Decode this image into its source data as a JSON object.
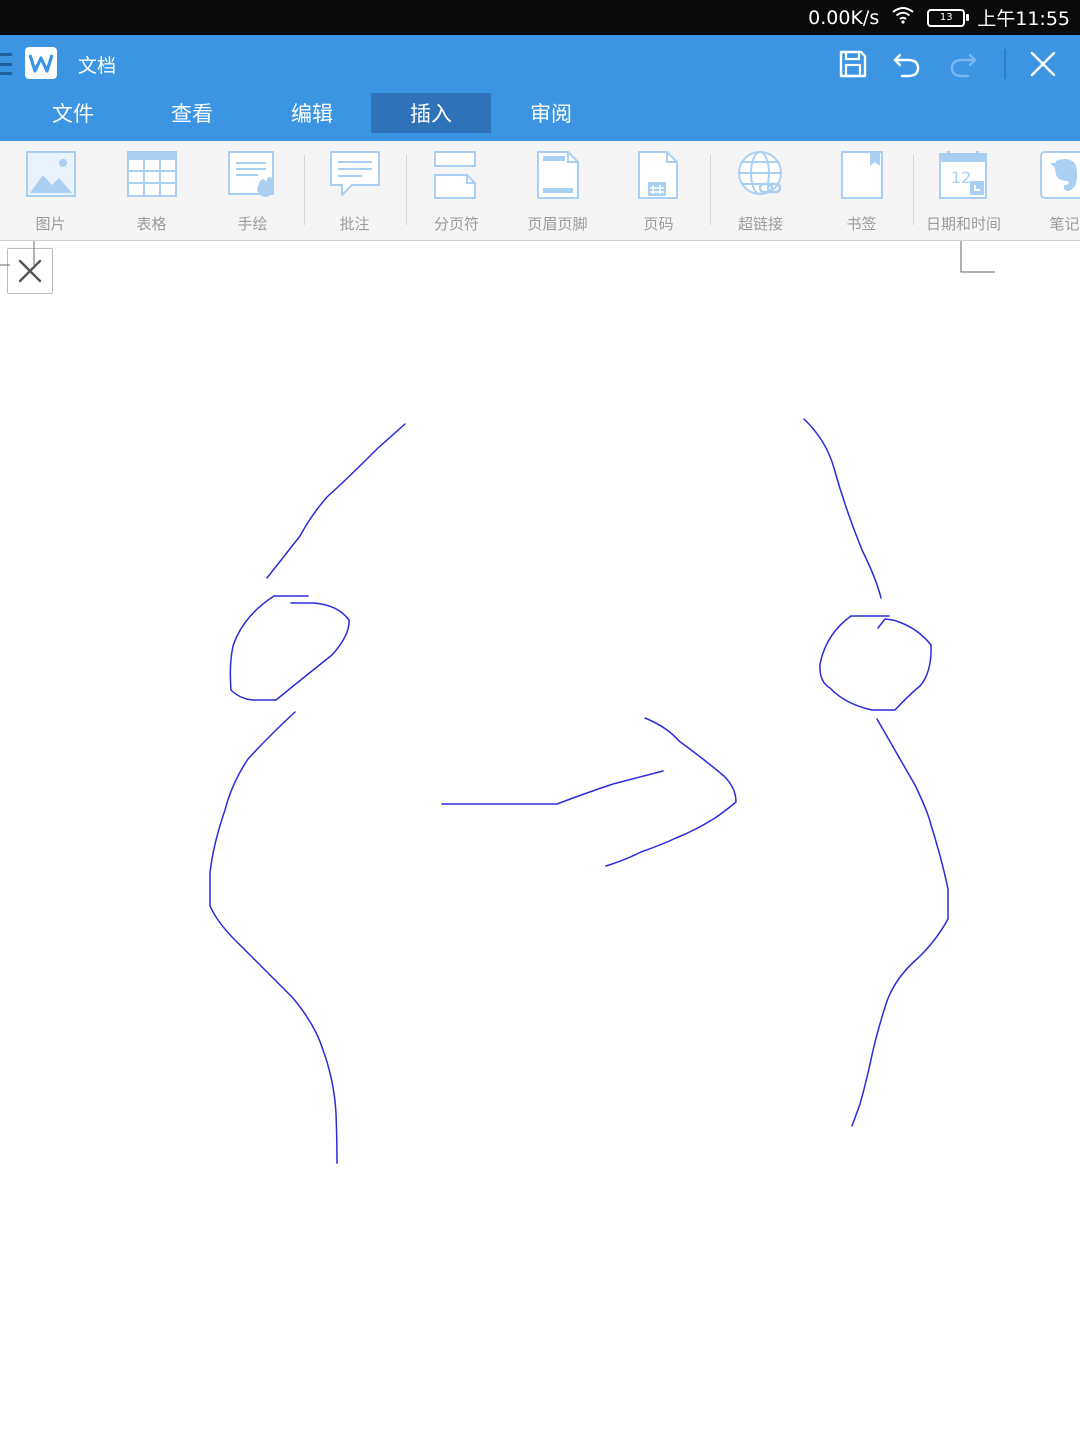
{
  "status_bar": {
    "network_speed": "0.00K/s",
    "battery_level": "13",
    "time": "上午11:55",
    "icons": [
      "wifi-icon",
      "battery-icon"
    ]
  },
  "title_bar": {
    "app_icon": "wps-writer-icon",
    "doc_title": "文档",
    "actions": [
      "save-icon",
      "undo-icon",
      "redo-icon",
      "close-icon"
    ]
  },
  "menu": {
    "tabs": [
      {
        "label": "文件"
      },
      {
        "label": "查看"
      },
      {
        "label": "编辑"
      },
      {
        "label": "插入",
        "active": true
      },
      {
        "label": "审阅"
      }
    ]
  },
  "ribbon": {
    "items": [
      {
        "label": "图片",
        "icon": "picture-icon"
      },
      {
        "label": "表格",
        "icon": "table-icon"
      },
      {
        "label": "手绘",
        "icon": "handwriting-icon"
      },
      {
        "label": "批注",
        "icon": "comment-icon"
      },
      {
        "label": "分页符",
        "icon": "page-break-icon"
      },
      {
        "label": "页眉页脚",
        "icon": "header-footer-icon"
      },
      {
        "label": "页码",
        "icon": "page-number-icon"
      },
      {
        "label": "超链接",
        "icon": "hyperlink-icon"
      },
      {
        "label": "书签",
        "icon": "bookmark-icon"
      },
      {
        "label": "日期和时间",
        "icon": "calendar-icon",
        "badge": "12"
      },
      {
        "label": "笔记",
        "icon": "evernote-icon"
      }
    ]
  },
  "colors": {
    "status_bar": "#0a0a0a",
    "title_bar": "#3c95e2",
    "active_tab": "#2f72b8",
    "ribbon_bg": "#f5f5f5",
    "ribbon_icon": "#a9d0f2",
    "ribbon_text": "#9a9a9a",
    "ink": "#2b2bd9"
  }
}
